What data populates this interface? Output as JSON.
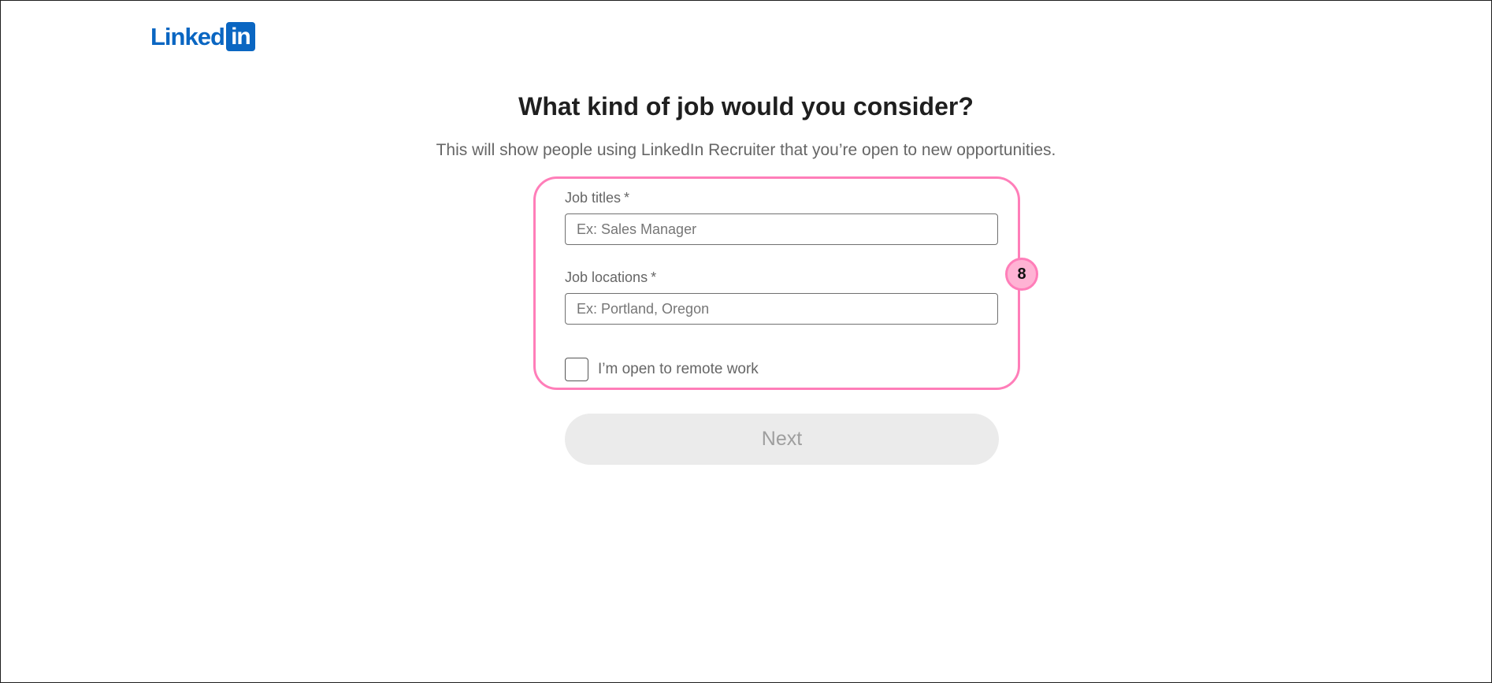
{
  "brand": {
    "logo_text": "Linked",
    "logo_box_text": "in",
    "color": "#0a66c2"
  },
  "page": {
    "title": "What kind of job would you consider?",
    "subtitle": "This will show people using LinkedIn Recruiter that you’re open to new opportunities."
  },
  "form": {
    "job_titles": {
      "label": "Job titles",
      "required_mark": "*",
      "placeholder": "Ex: Sales Manager",
      "value": ""
    },
    "job_locations": {
      "label": "Job locations",
      "required_mark": "*",
      "placeholder": "Ex: Portland, Oregon",
      "value": ""
    },
    "remote": {
      "label": "I’m open to remote work",
      "checked": false
    },
    "next_label": "Next"
  },
  "annotation": {
    "badge_number": "8",
    "highlight_color": "#ff7eb9"
  }
}
